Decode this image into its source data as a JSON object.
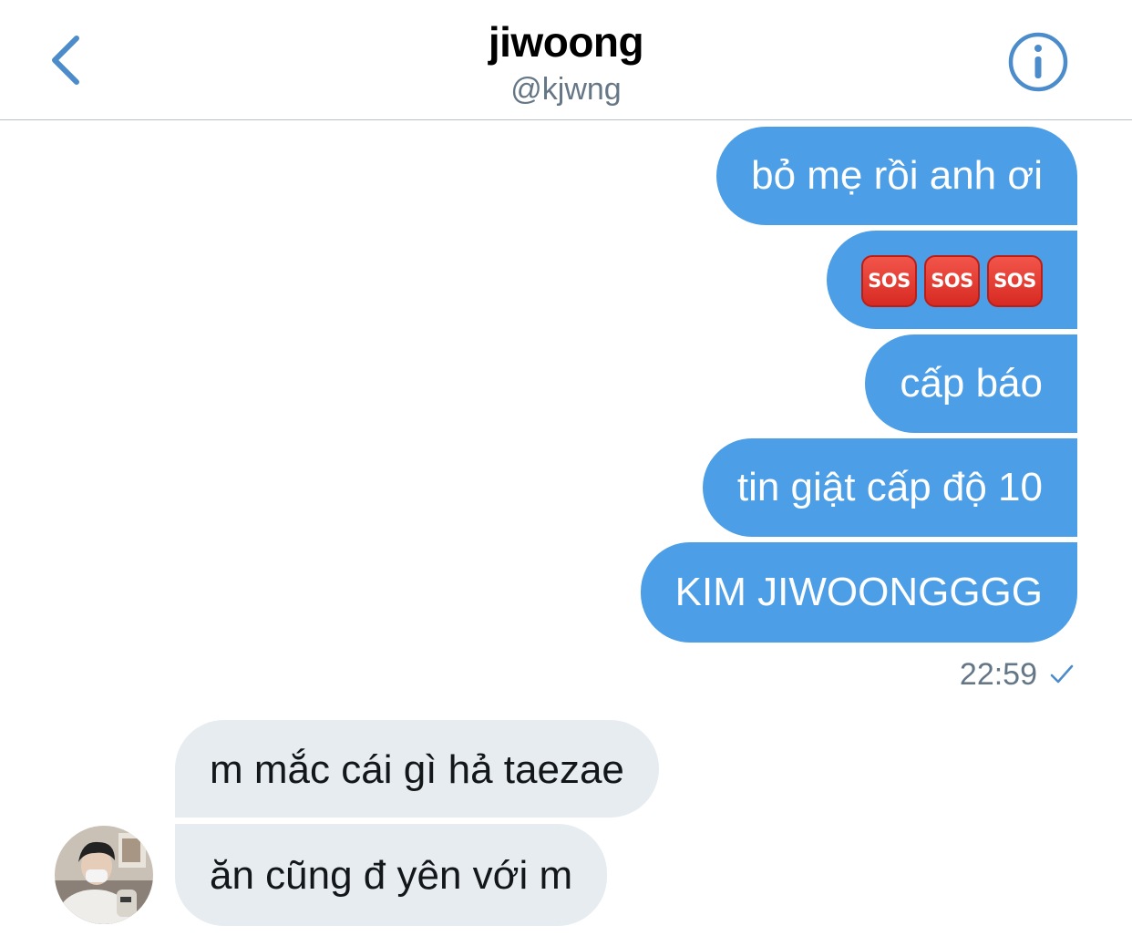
{
  "header": {
    "display_name": "jiwoong",
    "handle": "@kjwng",
    "back_icon": "chevron-left-icon",
    "info_icon": "info-icon"
  },
  "colors": {
    "accent": "#4c9ee6",
    "incoming_bubble": "#e6ecf0",
    "secondary_text": "#657786"
  },
  "messages": {
    "outgoing": [
      {
        "text": "bỏ mẹ rồi anh ơi"
      },
      {
        "emoji": [
          "SOS",
          "SOS",
          "SOS"
        ]
      },
      {
        "text": "cấp báo"
      },
      {
        "text": "tin giật cấp độ 10"
      },
      {
        "text": "KIM JIWOONGGGG"
      }
    ],
    "outgoing_time": "22:59",
    "incoming": [
      {
        "text": "m mắc cái gì hả taezae"
      },
      {
        "text": "ăn cũng đ yên với m"
      }
    ]
  }
}
